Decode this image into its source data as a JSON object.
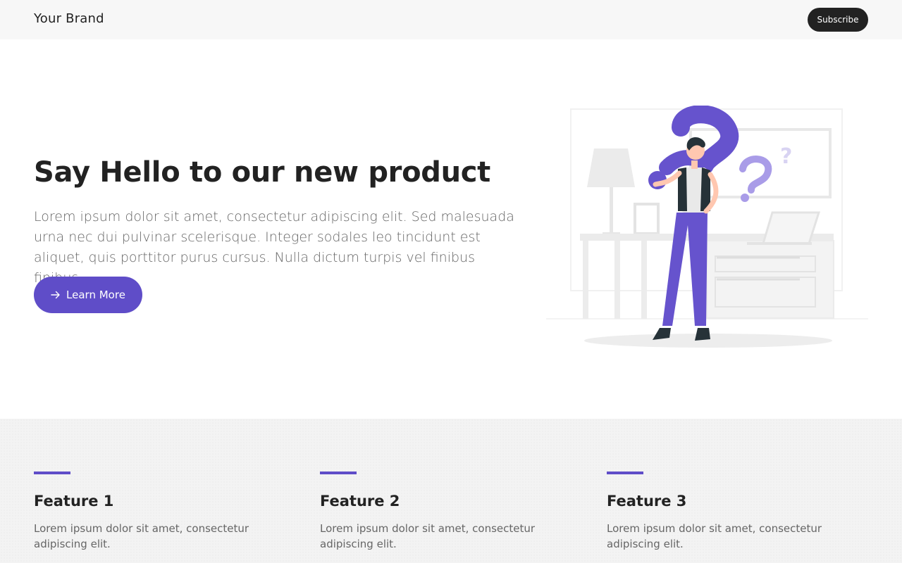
{
  "header": {
    "brand": "Your Brand",
    "subscribe_label": "Subscribe"
  },
  "hero": {
    "title": "Say Hello to our new product",
    "text": "Lorem ipsum dolor sit amet, consectetur adipiscing elit. Sed malesuada urna nec dui pulvinar scelerisque. Integer sodales leo tincidunt est aliquet, quis porttitor purus cursus. Nulla dictum turpis vel finibus finibus.",
    "cta_label": "Learn More",
    "cta_icon": "arrow-right-icon",
    "illustration": "person-with-question-marks"
  },
  "features": [
    {
      "title": "Feature 1",
      "text": "Lorem ipsum dolor sit amet, consectetur adipiscing elit."
    },
    {
      "title": "Feature 2",
      "text": "Lorem ipsum dolor sit amet, consectetur adipiscing elit."
    },
    {
      "title": "Feature 3",
      "text": "Lorem ipsum dolor sit amet, consectetur adipiscing elit."
    }
  ],
  "colors": {
    "accent": "#5f4dc8",
    "dark": "#222222",
    "header_bg": "#f7f7f7",
    "features_bg": "#f3f3f3"
  }
}
